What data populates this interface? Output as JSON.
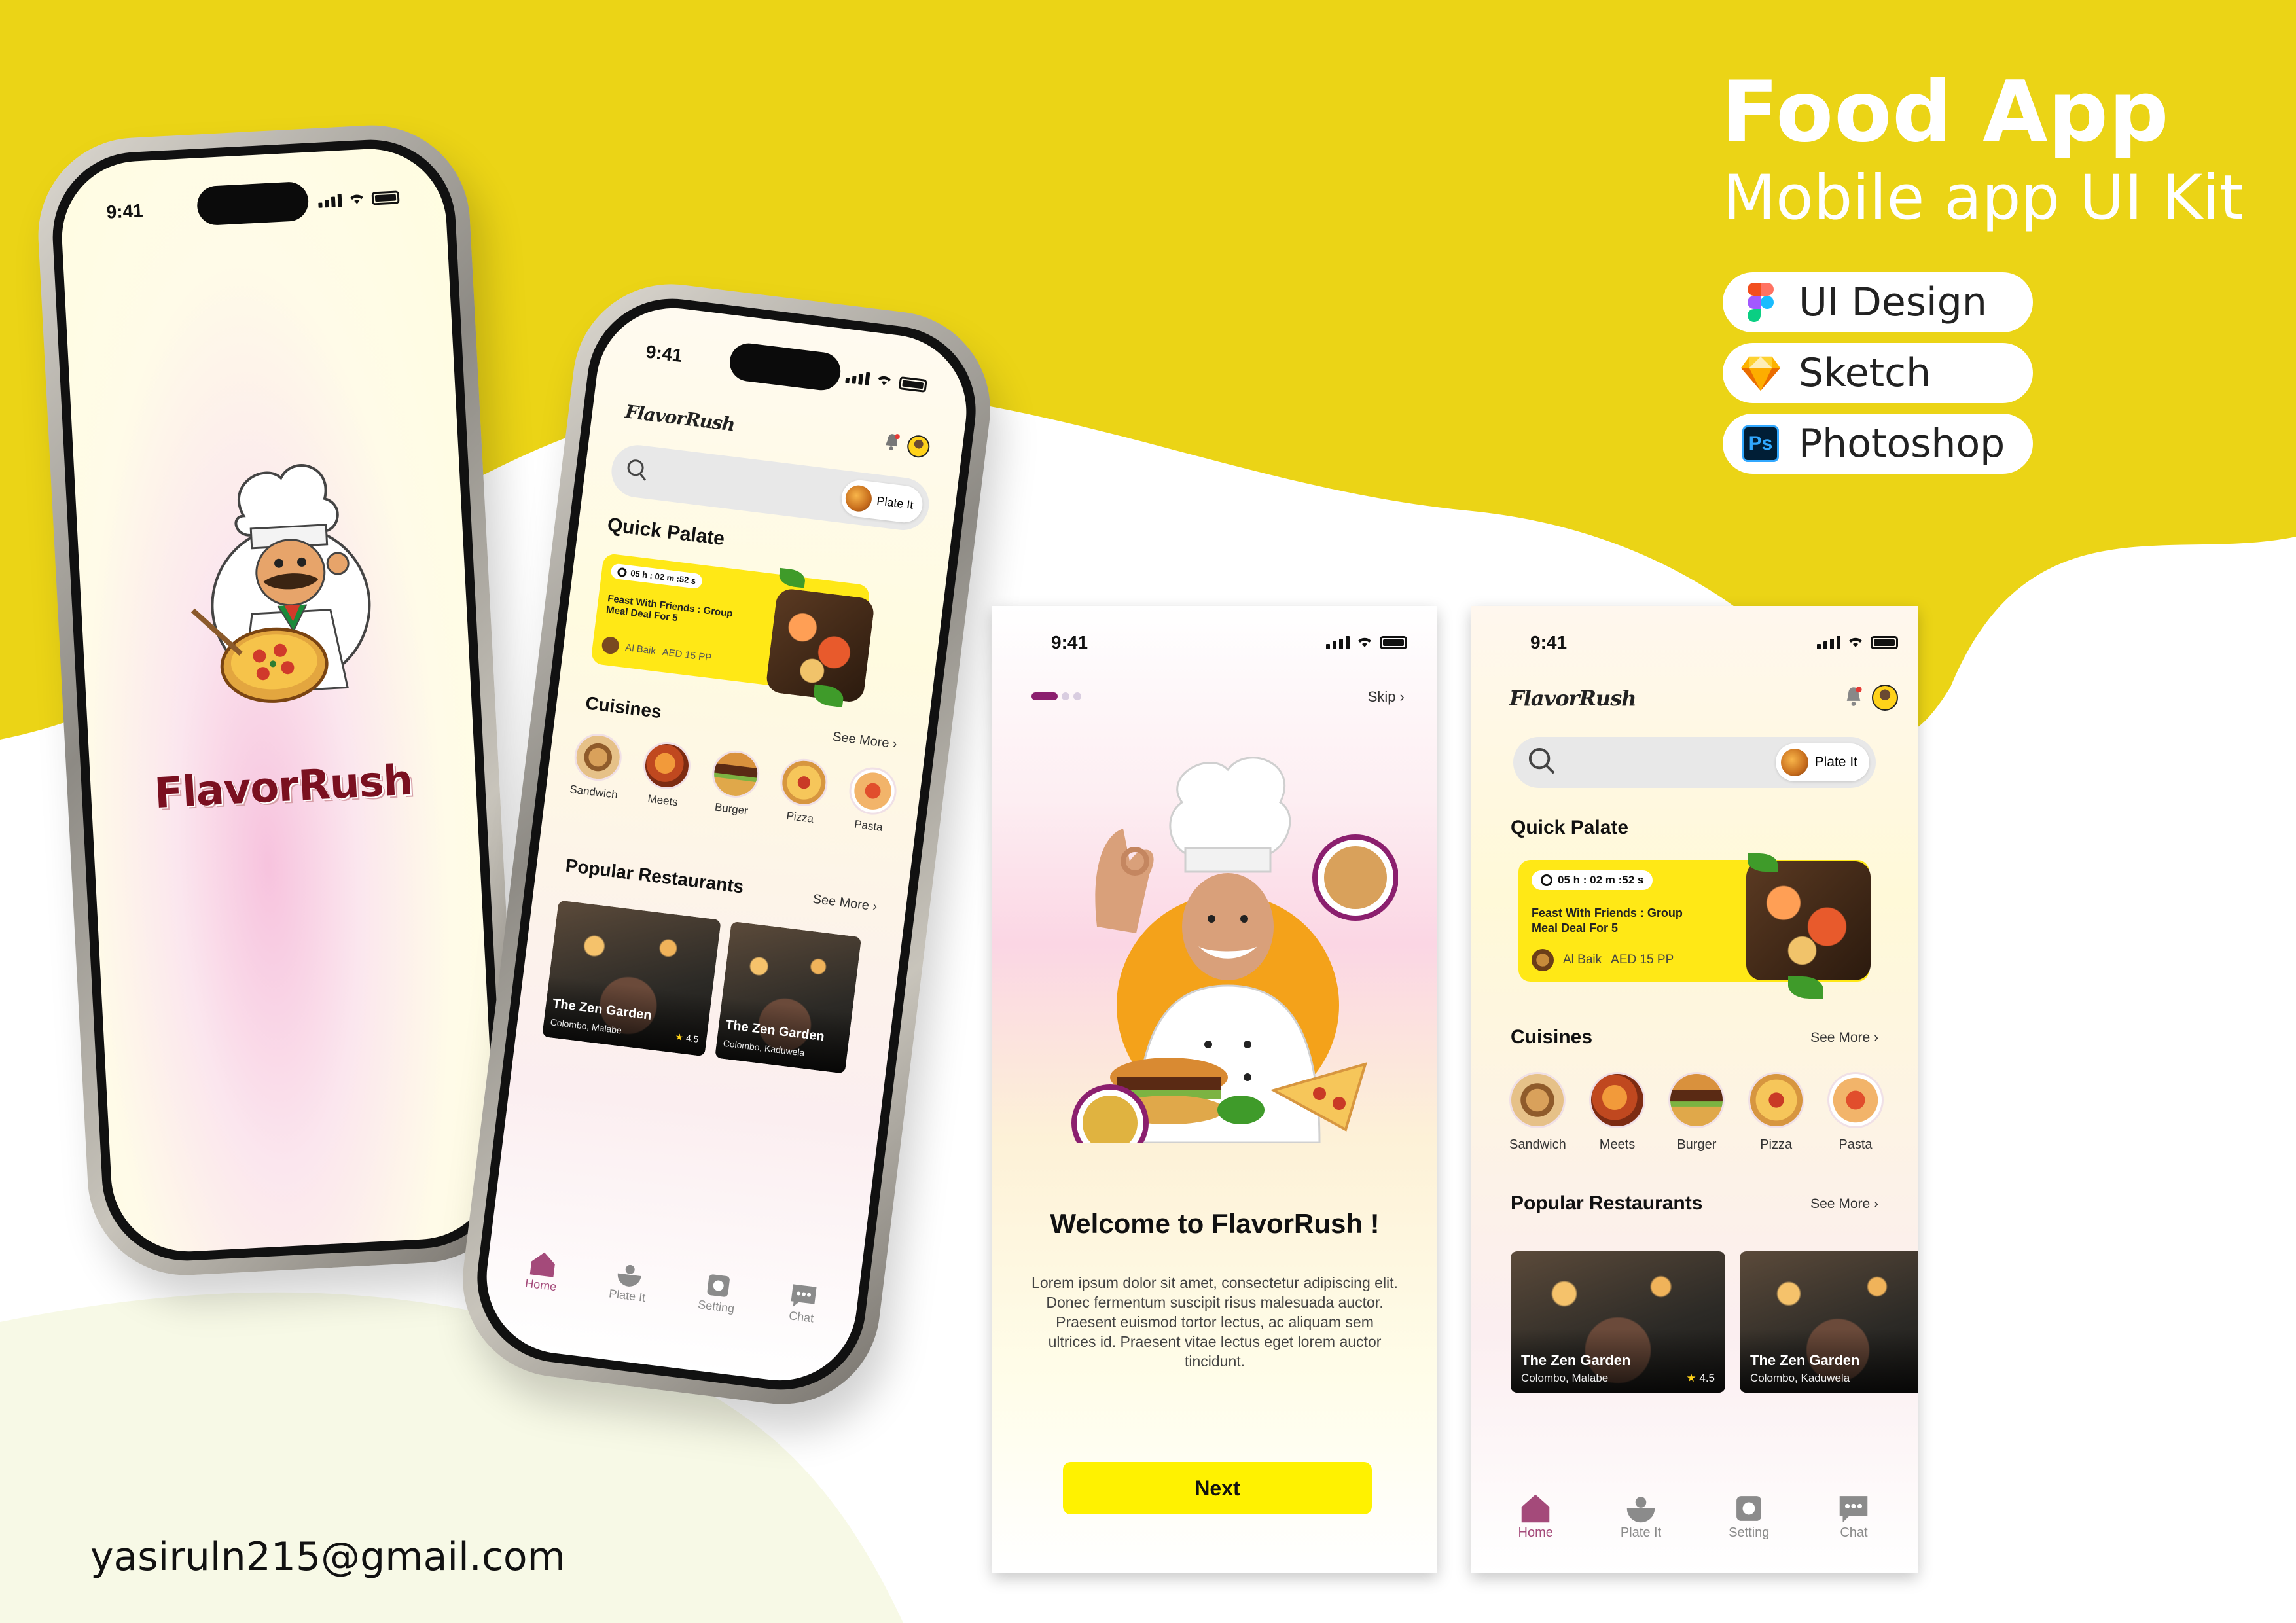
{
  "header": {
    "title": "Food App",
    "subtitle": "Mobile app UI Kit"
  },
  "tools": [
    {
      "label": "UI Design",
      "icon": "figma-icon"
    },
    {
      "label": "Sketch",
      "icon": "sketch-icon"
    },
    {
      "label": "Photoshop",
      "icon": "photoshop-icon",
      "badge": "Ps"
    }
  ],
  "email": "yasiruln215@gmail.com",
  "colors": {
    "background_yellow": "#ebd416",
    "accent_yellow": "#ffe816",
    "accent_purple": "#a44a7a",
    "button_yellow": "#fff200"
  },
  "status_bar": {
    "time": "9:41"
  },
  "splash": {
    "brand": "FlavorRush",
    "mascot": "chef-pizza-mascot"
  },
  "welcome": {
    "skip_label": "Skip",
    "title": "Welcome to FlavorRush !",
    "body": "Lorem ipsum dolor sit amet, consectetur adipiscing elit. Donec fermentum suscipit risus malesuada auctor. Praesent euismod tortor lectus, ac aliquam sem ultrices id. Praesent vitae lectus eget lorem auctor tincidunt.",
    "next_label": "Next"
  },
  "home": {
    "logo": "FlavorRush",
    "search": {
      "placeholder": "",
      "chip_label": "Plate It"
    },
    "quick_palate": {
      "title": "Quick Palate",
      "timer": "05 h : 02 m :52 s",
      "deal": "Feast With Friends : Group Meal Deal For 5",
      "restaurant": "Al Baik",
      "price": "AED 15 PP"
    },
    "cuisines": {
      "title": "Cuisines",
      "see_more": "See More",
      "items": [
        {
          "label": "Sandwich"
        },
        {
          "label": "Meets"
        },
        {
          "label": "Burger"
        },
        {
          "label": "Pizza"
        },
        {
          "label": "Pasta"
        }
      ]
    },
    "popular": {
      "title": "Popular Restaurants",
      "see_more": "See More",
      "items": [
        {
          "name": "The Zen Garden",
          "location": "Colombo, Malabe",
          "rating": "4.5"
        },
        {
          "name": "The Zen Garden",
          "location": "Colombo, Kaduwela",
          "rating": ""
        }
      ]
    },
    "tabs": [
      {
        "label": "Home",
        "icon": "home-icon"
      },
      {
        "label": "Plate It",
        "icon": "plate-icon"
      },
      {
        "label": "Setting",
        "icon": "gear-icon"
      },
      {
        "label": "Chat",
        "icon": "chat-icon"
      }
    ]
  }
}
